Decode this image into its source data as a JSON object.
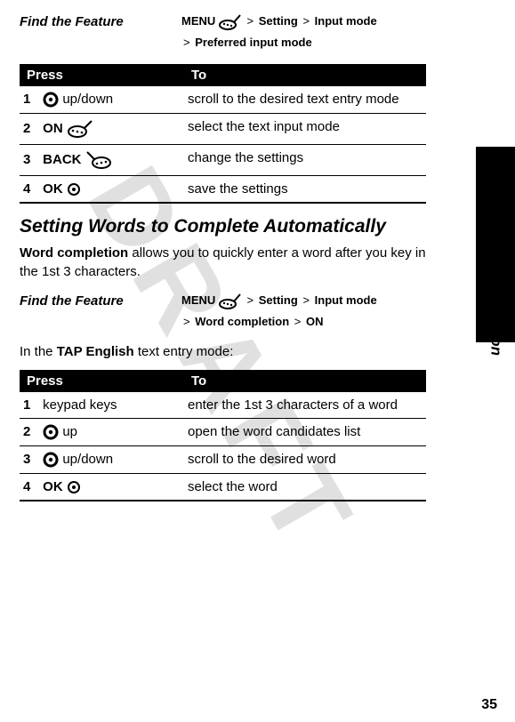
{
  "sideTab": "Basic Operation",
  "pageNumber": "35",
  "watermark": "DRAFT",
  "feature1": {
    "label": "Find the Feature",
    "menu": "MENU",
    "s1": "Setting",
    "s2": "Input mode",
    "s3": "Preferred input mode"
  },
  "table1": {
    "hPress": "Press",
    "hTo": "To",
    "rows": [
      {
        "n": "1",
        "press": "up/down",
        "icon": "dpad",
        "to": "scroll to the desired text entry mode"
      },
      {
        "n": "2",
        "press": "ON",
        "icon": "soft-left",
        "to": "select the text input mode"
      },
      {
        "n": "3",
        "press": "BACK",
        "icon": "soft-right",
        "to": "change the settings"
      },
      {
        "n": "4",
        "press": "OK",
        "icon": "center",
        "to": "save the settings"
      }
    ]
  },
  "sectionTitle": "Setting Words to Complete Automatically",
  "para1a": "Word completion",
  "para1b": " allows you to quickly enter a word after you key in the 1st 3 characters.",
  "feature2": {
    "label": "Find the Feature",
    "menu": "MENU",
    "s1": "Setting",
    "s2": "Input mode",
    "s3": "Word completion",
    "s4": "ON"
  },
  "para2a": "In the ",
  "para2b": "TAP English",
  "para2c": " text entry mode:",
  "table2": {
    "hPress": "Press",
    "hTo": "To",
    "rows": [
      {
        "n": "1",
        "press": "keypad keys",
        "icon": "",
        "to": "enter the 1st 3 characters of a word"
      },
      {
        "n": "2",
        "press": "up",
        "icon": "dpad",
        "to": "open the word candidates list"
      },
      {
        "n": "3",
        "press": "up/down",
        "icon": "dpad",
        "to": "scroll to the desired word"
      },
      {
        "n": "4",
        "press": "OK",
        "icon": "center",
        "to": "select the word"
      }
    ]
  }
}
